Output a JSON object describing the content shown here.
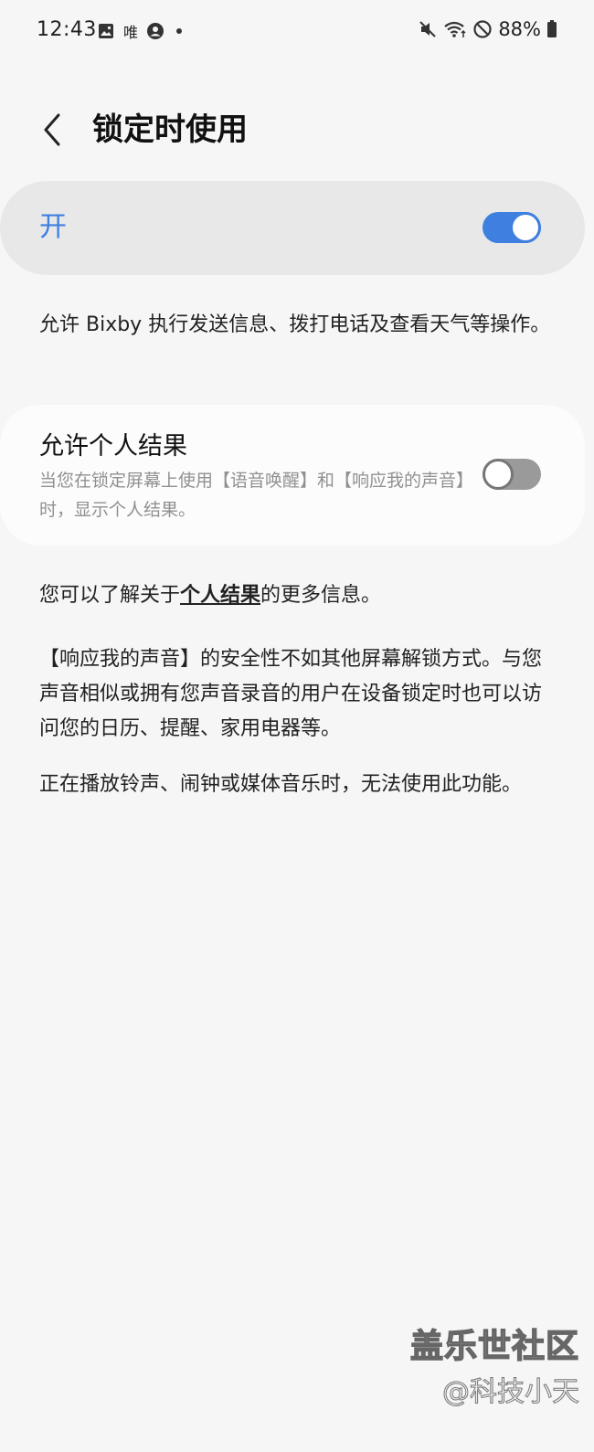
{
  "status_bar": {
    "time": "12:43",
    "left_icons": [
      "image-icon",
      "wei-icon",
      "account-icon",
      "dot-icon"
    ],
    "wei_label": "唯",
    "right_icons": [
      "mute-icon",
      "wifi-icon",
      "no-disturb-icon",
      "battery-icon"
    ],
    "battery": "88%"
  },
  "header": {
    "back_icon": "chevron-left-icon",
    "title": "锁定时使用"
  },
  "master_switch": {
    "label": "开",
    "state": "on",
    "accent": "#3e7fe0"
  },
  "description_1": "允许 Bixby 执行发送信息、拨打电话及查看天气等操作。",
  "personal_results": {
    "title": "允许个人结果",
    "subtitle": "当您在锁定屏幕上使用【语音唤醒】和【响应我的声音】时，显示个人结果。",
    "state": "off"
  },
  "info": {
    "prefix": "您可以了解关于",
    "link": "个人结果",
    "suffix": "的更多信息。"
  },
  "description_2": "【响应我的声音】的安全性不如其他屏幕解锁方式。与您声音相似或拥有您声音录音的用户在设备锁定时也可以访问您的日历、提醒、家用电器等。",
  "description_3": "正在播放铃声、闹钟或媒体音乐时，无法使用此功能。",
  "watermark": {
    "brand": "盖乐世社区",
    "author": "@科技小天"
  }
}
